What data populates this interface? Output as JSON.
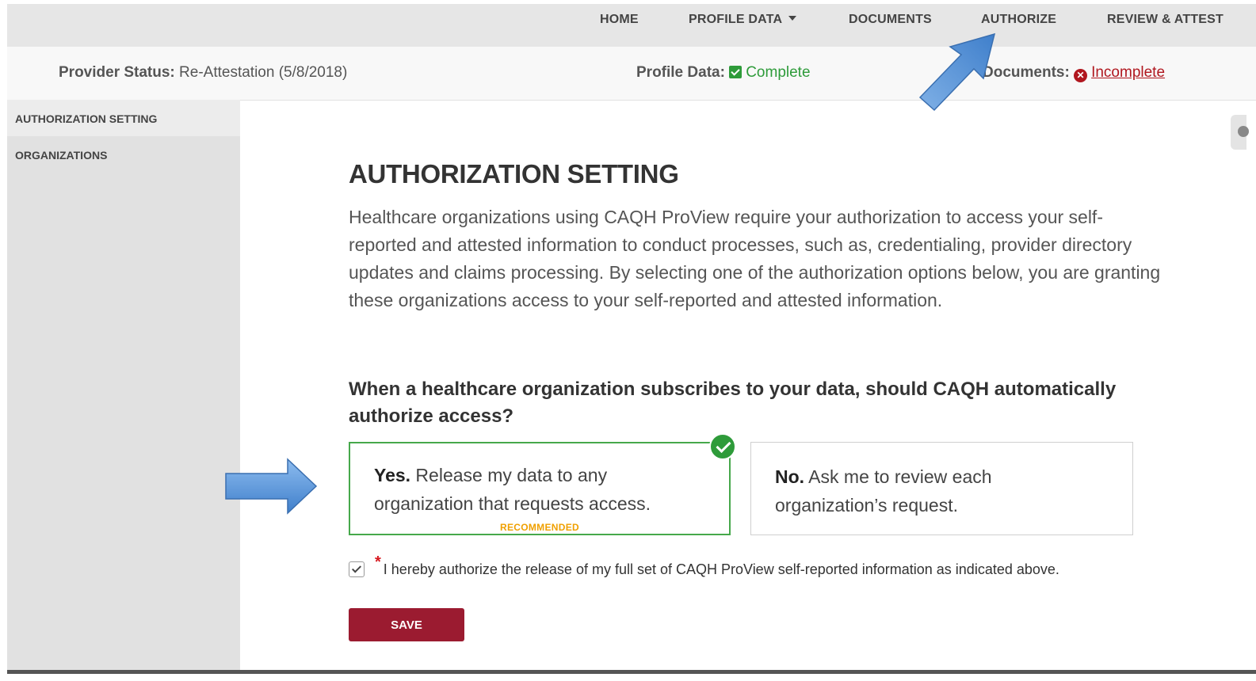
{
  "nav": {
    "items": [
      {
        "label": "HOME"
      },
      {
        "label": "PROFILE DATA"
      },
      {
        "label": "DOCUMENTS"
      },
      {
        "label": "AUTHORIZE"
      },
      {
        "label": "REVIEW & ATTEST"
      }
    ]
  },
  "status": {
    "provider_label": "Provider Status:",
    "provider_value": "Re-Attestation (5/8/2018)",
    "profile_label": "Profile Data:",
    "profile_value": "Complete",
    "documents_label": "Documents:",
    "documents_value": "Incomplete"
  },
  "sidebar": {
    "items": [
      {
        "label": "AUTHORIZATION SETTING"
      },
      {
        "label": "ORGANIZATIONS"
      }
    ]
  },
  "main": {
    "title": "AUTHORIZATION SETTING",
    "intro": "Healthcare organizations using CAQH ProView require your authorization to access your self-reported and attested information to conduct processes, such as, credentialing, provider directory updates and claims processing. By selecting one of the authorization options below, you are granting these organizations access to your self-reported and attested information.",
    "question": "When a healthcare organization subscribes to your data, should CAQH automatically authorize access?",
    "option_yes": {
      "lead": "Yes.",
      "text": " Release my data to any organization that requests access.",
      "badge": "RECOMMENDED"
    },
    "option_no": {
      "lead": "No.",
      "text": " Ask me to review each organization’s request."
    },
    "consent_required": "*",
    "consent_text": "I hereby authorize the release of my full set of CAQH ProView self-reported information as indicated above.",
    "save_label": "SAVE"
  },
  "colors": {
    "accent": "#9b1b30",
    "success": "#2e9b3a",
    "error": "#b0171f",
    "annotation_arrow": "#5b9bd5"
  }
}
